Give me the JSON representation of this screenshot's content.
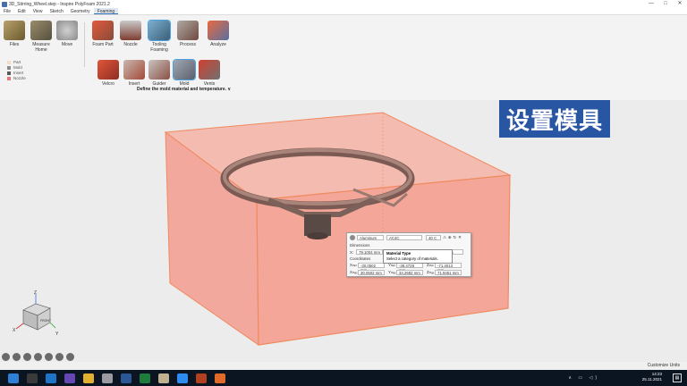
{
  "window": {
    "title": "3D_Stirring_Wheel.step - Inspire PolyFoam 2021.2",
    "minimize": "—",
    "maximize": "□",
    "close": "✕"
  },
  "menu": [
    "File",
    "Edit",
    "View",
    "Sketch",
    "Geometry",
    "Foaming"
  ],
  "ribbon": {
    "row1": [
      "Files",
      "Measure\nHome",
      "Move",
      "Foam Part",
      "Nozzle",
      "Tooling\nFoaming",
      "Process",
      "Analyze"
    ],
    "row2": [
      "Velcro",
      "Insert",
      "Guider",
      "Mold",
      "Vents"
    ],
    "hint": "Define the mold material and temperature.",
    "hint_arrow": "∨"
  },
  "legend": [
    {
      "label": "Part",
      "color": "#f2ddc9"
    },
    {
      "label": "Mold",
      "color": "#8c8c8c"
    },
    {
      "label": "Insert",
      "color": "#5a5a5a"
    },
    {
      "label": "Nozzle",
      "color": "#e07a78"
    }
  ],
  "banner": {
    "text": "设置模具",
    "color": "#2956a3"
  },
  "dialog": {
    "material_category": "Aluminum",
    "material": "AC4C",
    "temperature": "40 C",
    "dimensions_label": "Dimensions",
    "x_label": "X:",
    "x_value": "79.1004 mm",
    "y_value": "463 mm",
    "coordinates_label": "Coordinates",
    "xmin_label": "Xₘᵢₙ",
    "xmin_value": "-30.0502 mm",
    "ymin_label": "Yₘᵢₙ",
    "ymin_value": "-38.4728 mm",
    "zmin_label": "Zₘᵢₙ",
    "zmin_value": "-71.4013 mm",
    "xmax_label": "Xₘₐₓ",
    "xmax_value": "30.0502 mm",
    "ymax_label": "Yₘₐₓ",
    "ymax_value": "34.2682 mm",
    "zmax_label": "Zₘₐₓ",
    "zmax_value": "71.9451 mm"
  },
  "tooltip": {
    "title": "Material Type",
    "body": "Select a category of materials."
  },
  "triad": {
    "x": "X",
    "y": "Y",
    "z": "Z",
    "front": "FRONT"
  },
  "status": {
    "units": "Customize Units"
  },
  "clock": {
    "time": "14:23",
    "date": "25.11.2021"
  },
  "tray": "∧ ▭ ◁)",
  "notif": "▤",
  "colors": {
    "mold_box": "#f4a191",
    "mold_edge": "#f08a5e",
    "wheel": "#8f6e66"
  }
}
